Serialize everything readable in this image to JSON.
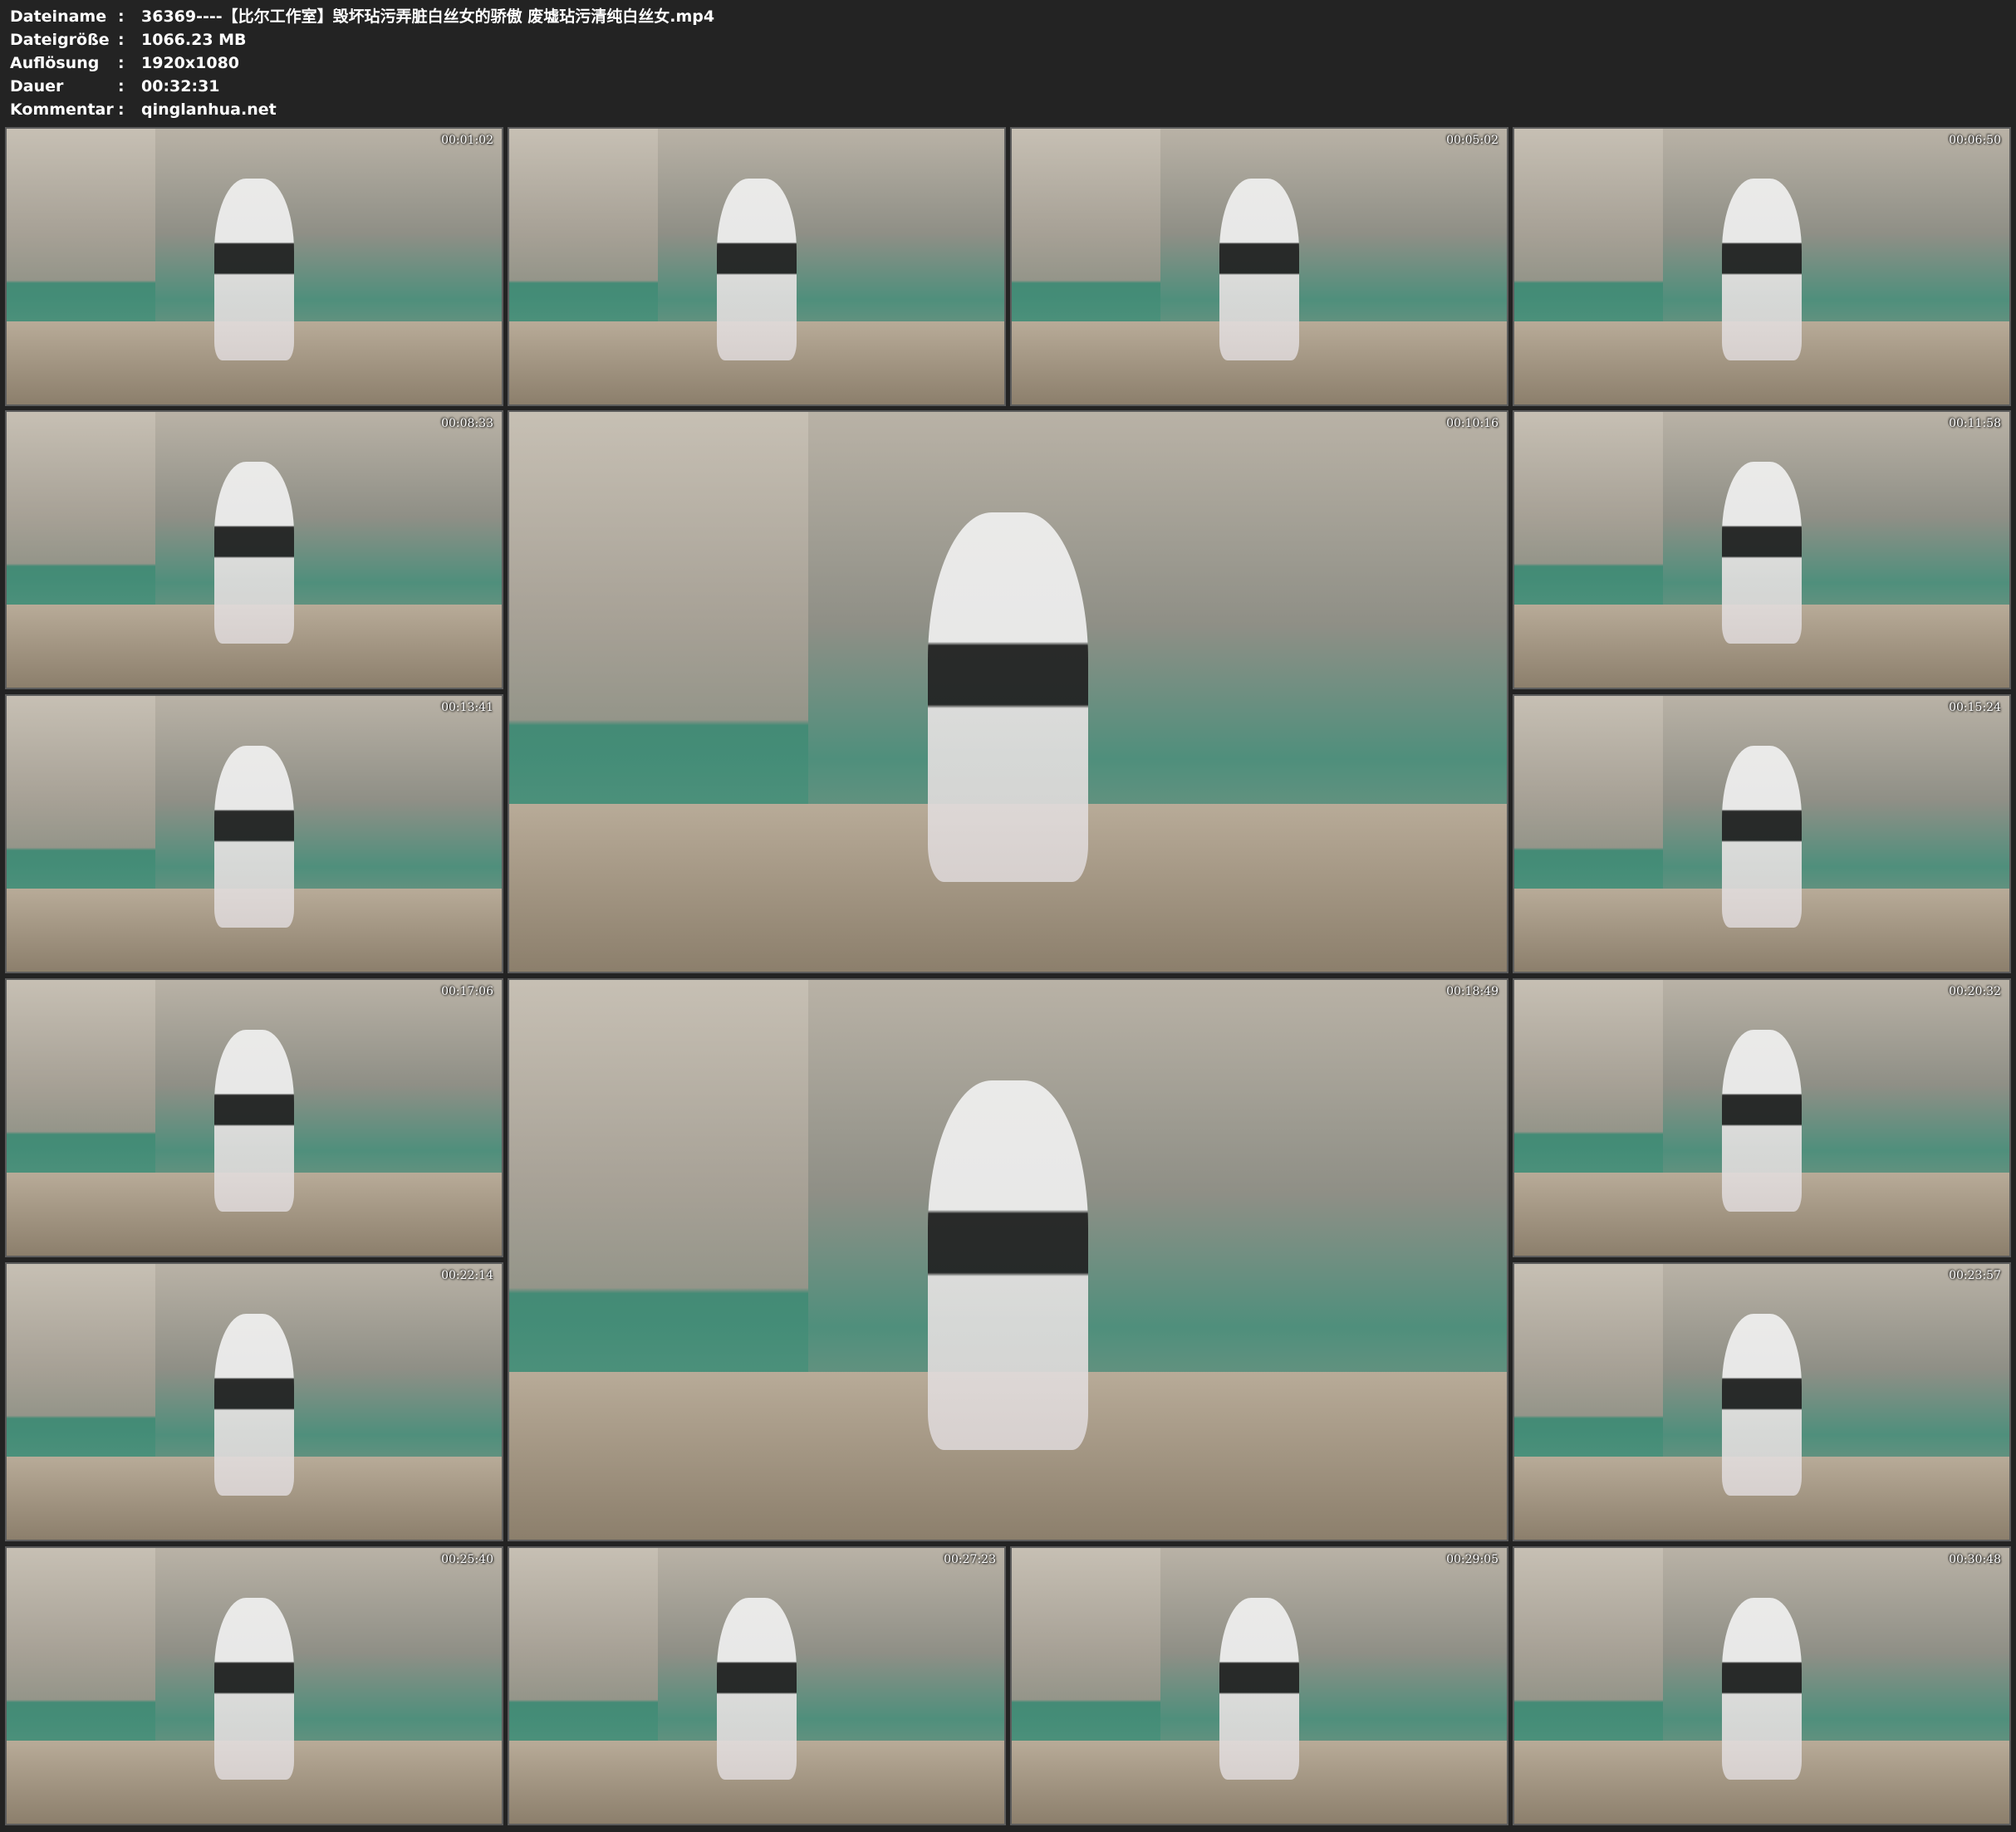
{
  "meta": {
    "rows": [
      {
        "label": "Dateiname",
        "value": "36369----【比尔工作室】毁坏玷污弄脏白丝女的骄傲 废墟玷污清纯白丝女.mp4"
      },
      {
        "label": "Dateigröße",
        "value": "1066.23 MB"
      },
      {
        "label": "Auflösung",
        "value": "1920x1080"
      },
      {
        "label": "Dauer",
        "value": "00:32:31"
      },
      {
        "label": "Kommentar",
        "value": "qinglanhua.net"
      }
    ],
    "separator": ":"
  },
  "thumbnails": [
    {
      "timestamp": "00:01:02"
    },
    {
      "timestamp": ""
    },
    {
      "timestamp": "00:05:02"
    },
    {
      "timestamp": "00:06:50"
    },
    {
      "timestamp": "00:08:33"
    },
    {
      "timestamp": "00:10:16"
    },
    {
      "timestamp": "00:11:58"
    },
    {
      "timestamp": "00:13:41"
    },
    {
      "timestamp": "00:15:24"
    },
    {
      "timestamp": "00:17:06"
    },
    {
      "timestamp": "00:18:49"
    },
    {
      "timestamp": "00:20:32"
    },
    {
      "timestamp": "00:22:14"
    },
    {
      "timestamp": "00:23:57"
    },
    {
      "timestamp": "00:25:40"
    },
    {
      "timestamp": "00:27:23"
    },
    {
      "timestamp": "00:29:05"
    },
    {
      "timestamp": "00:30:48"
    }
  ]
}
